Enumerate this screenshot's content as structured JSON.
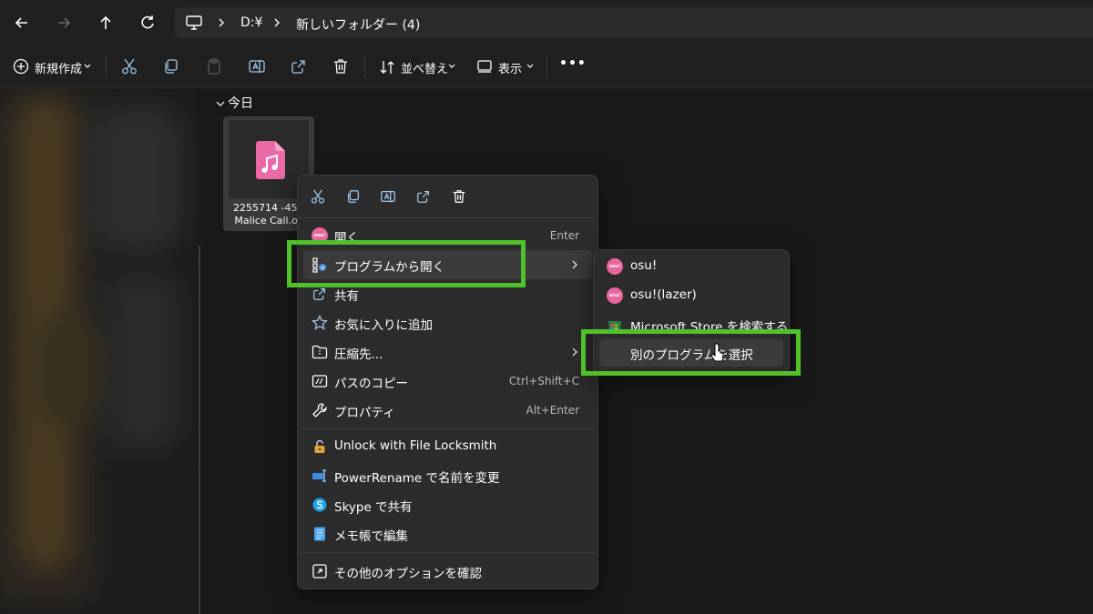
{
  "address": {
    "nav_icons": [
      "back-icon",
      "forward-icon",
      "up-icon",
      "refresh-icon"
    ],
    "computer_icon": "monitor-icon",
    "crumbs": [
      "D:¥",
      "新しいフォルダー (4)"
    ]
  },
  "commandbar": {
    "new_label": "新規作成",
    "sort_label": "並べ替え",
    "view_label": "表示",
    "more_label": "•••"
  },
  "content": {
    "group_header": "今日",
    "file": {
      "name_line1": "2255714 -45 -",
      "name_line2": "Malice Call.os"
    }
  },
  "context_menu": {
    "quick_actions": [
      "cut-icon",
      "copy-icon",
      "rename-icon",
      "share-icon",
      "delete-icon"
    ],
    "items": [
      {
        "label": "開く",
        "shortcut": "Enter",
        "icon": "osu-icon"
      },
      {
        "label": "プログラムから開く",
        "shortcut": "",
        "icon": "open-with-icon",
        "submenu": true
      },
      {
        "label": "共有",
        "shortcut": "",
        "icon": "share-icon"
      },
      {
        "label": "お気に入りに追加",
        "shortcut": "",
        "icon": "star-icon"
      },
      {
        "label": "圧縮先...",
        "shortcut": "",
        "icon": "archive-icon",
        "submenu": true
      },
      {
        "label": "パスのコピー",
        "shortcut": "Ctrl+Shift+C",
        "icon": "copy-path-icon"
      },
      {
        "label": "プロパティ",
        "shortcut": "Alt+Enter",
        "icon": "wrench-icon"
      }
    ],
    "extra_items": [
      {
        "label": "Unlock with File Locksmith",
        "icon": "lock-icon"
      },
      {
        "label": "PowerRename で名前を変更",
        "icon": "powerrename-icon"
      },
      {
        "label": "Skype で共有",
        "icon": "skype-icon"
      },
      {
        "label": "メモ帳で編集",
        "icon": "notepad-icon"
      }
    ],
    "more_options": {
      "label": "その他のオプションを確認",
      "icon": "more-options-icon"
    }
  },
  "submenu": {
    "items": [
      {
        "label": "osu!",
        "icon": "osu-icon"
      },
      {
        "label": "osu!(lazer)",
        "icon": "osu-lazer-icon"
      },
      {
        "label": "Microsoft Store を検索する",
        "icon": "store-icon"
      },
      {
        "label": "別のプログラムを選択",
        "icon": ""
      }
    ],
    "osu_badge_text": "osu!"
  },
  "colors": {
    "highlight_box": "#4fc229",
    "osu_pink": "#e7669e",
    "menu_bg": "#2c2c2c",
    "window_bg": "#191919"
  }
}
